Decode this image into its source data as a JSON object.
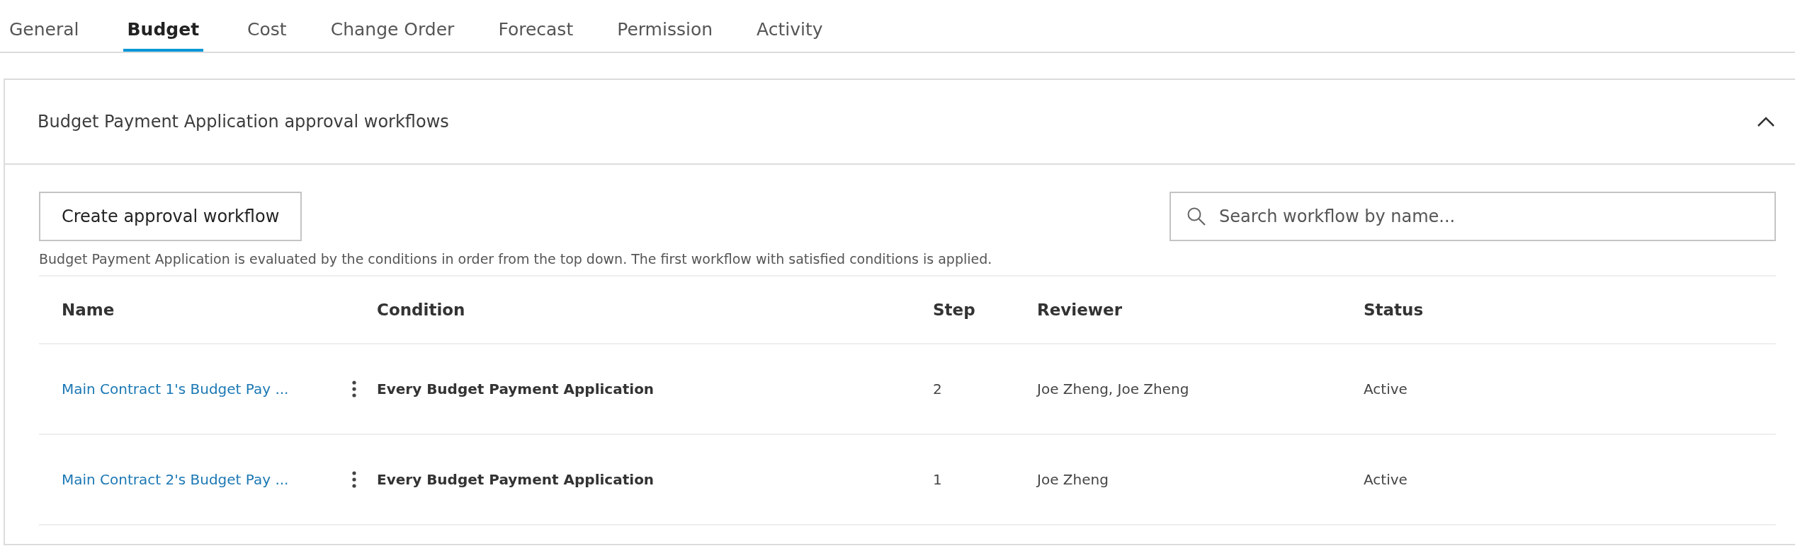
{
  "tabs": [
    {
      "label": "General",
      "selected": false
    },
    {
      "label": "Budget",
      "selected": true
    },
    {
      "label": "Cost",
      "selected": false
    },
    {
      "label": "Change Order",
      "selected": false
    },
    {
      "label": "Forecast",
      "selected": false
    },
    {
      "label": "Permission",
      "selected": false
    },
    {
      "label": "Activity",
      "selected": false
    }
  ],
  "panel": {
    "title": "Budget Payment Application approval workflows",
    "expanded": true,
    "create_button": "Create approval workflow",
    "search": {
      "placeholder": "Search workflow by name..."
    },
    "description": "Budget Payment Application is evaluated by the conditions in order from the top down. The first workflow with satisfied conditions is applied.",
    "table": {
      "columns": [
        "Name",
        "Condition",
        "Step",
        "Reviewer",
        "Status"
      ],
      "rows": [
        {
          "name": "Main Contract 1's Budget Pay ...",
          "condition": "Every Budget Payment Application",
          "step": "2",
          "reviewer": "Joe Zheng, Joe Zheng",
          "status": "Active"
        },
        {
          "name": "Main Contract 2's Budget Pay ...",
          "condition": "Every Budget Payment Application",
          "step": "1",
          "reviewer": "Joe Zheng",
          "status": "Active"
        }
      ]
    }
  }
}
